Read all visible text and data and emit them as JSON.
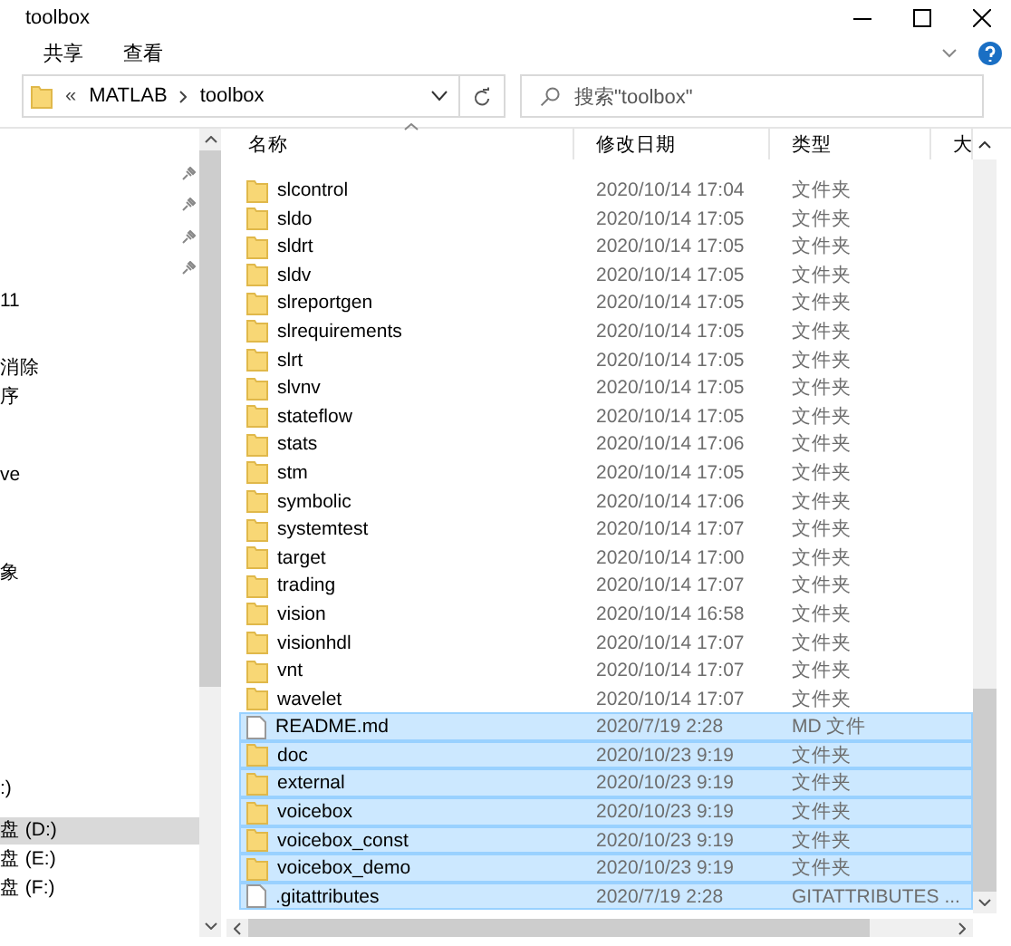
{
  "window": {
    "title": "toolbox"
  },
  "ribbon_tabs": [
    {
      "label": "共享"
    },
    {
      "label": "查看"
    }
  ],
  "address": {
    "overflow": "«",
    "segments": [
      "MATLAB",
      "toolbox"
    ]
  },
  "search": {
    "placeholder": "搜索\"toolbox\""
  },
  "nav_items": [
    {
      "kind": "pinned"
    },
    {
      "kind": "pinned"
    },
    {
      "kind": "pinned"
    },
    {
      "kind": "pinned"
    },
    {
      "kind": "item",
      "label": "11",
      "selected": false
    },
    {
      "kind": "item",
      "label": "消除",
      "selected": false
    },
    {
      "kind": "item",
      "label": "序",
      "selected": false
    },
    {
      "kind": "item",
      "label": "ve",
      "selected": false
    },
    {
      "kind": "item",
      "label": "象",
      "selected": false
    },
    {
      "kind": "item",
      "label": ":)",
      "selected": false
    },
    {
      "kind": "item",
      "label": "盘 (D:)",
      "selected": true
    },
    {
      "kind": "item",
      "label": "盘 (E:)",
      "selected": false
    },
    {
      "kind": "item",
      "label": "盘 (F:)",
      "selected": false
    }
  ],
  "columns": [
    "名称",
    "修改日期",
    "类型",
    "大"
  ],
  "files": [
    {
      "kind": "folder",
      "name": "slcontrol",
      "date": "2020/10/14 17:04",
      "type": "文件夹",
      "selected": false
    },
    {
      "kind": "folder",
      "name": "sldo",
      "date": "2020/10/14 17:05",
      "type": "文件夹",
      "selected": false
    },
    {
      "kind": "folder",
      "name": "sldrt",
      "date": "2020/10/14 17:05",
      "type": "文件夹",
      "selected": false
    },
    {
      "kind": "folder",
      "name": "sldv",
      "date": "2020/10/14 17:05",
      "type": "文件夹",
      "selected": false
    },
    {
      "kind": "folder",
      "name": "slreportgen",
      "date": "2020/10/14 17:05",
      "type": "文件夹",
      "selected": false
    },
    {
      "kind": "folder",
      "name": "slrequirements",
      "date": "2020/10/14 17:05",
      "type": "文件夹",
      "selected": false
    },
    {
      "kind": "folder",
      "name": "slrt",
      "date": "2020/10/14 17:05",
      "type": "文件夹",
      "selected": false
    },
    {
      "kind": "folder",
      "name": "slvnv",
      "date": "2020/10/14 17:05",
      "type": "文件夹",
      "selected": false
    },
    {
      "kind": "folder",
      "name": "stateflow",
      "date": "2020/10/14 17:05",
      "type": "文件夹",
      "selected": false
    },
    {
      "kind": "folder",
      "name": "stats",
      "date": "2020/10/14 17:06",
      "type": "文件夹",
      "selected": false
    },
    {
      "kind": "folder",
      "name": "stm",
      "date": "2020/10/14 17:05",
      "type": "文件夹",
      "selected": false
    },
    {
      "kind": "folder",
      "name": "symbolic",
      "date": "2020/10/14 17:06",
      "type": "文件夹",
      "selected": false
    },
    {
      "kind": "folder",
      "name": "systemtest",
      "date": "2020/10/14 17:07",
      "type": "文件夹",
      "selected": false
    },
    {
      "kind": "folder",
      "name": "target",
      "date": "2020/10/14 17:00",
      "type": "文件夹",
      "selected": false
    },
    {
      "kind": "folder",
      "name": "trading",
      "date": "2020/10/14 17:07",
      "type": "文件夹",
      "selected": false
    },
    {
      "kind": "folder",
      "name": "vision",
      "date": "2020/10/14 16:58",
      "type": "文件夹",
      "selected": false
    },
    {
      "kind": "folder",
      "name": "visionhdl",
      "date": "2020/10/14 17:07",
      "type": "文件夹",
      "selected": false
    },
    {
      "kind": "folder",
      "name": "vnt",
      "date": "2020/10/14 17:07",
      "type": "文件夹",
      "selected": false
    },
    {
      "kind": "folder",
      "name": "wavelet",
      "date": "2020/10/14 17:07",
      "type": "文件夹",
      "selected": false
    },
    {
      "kind": "file",
      "name": "README.md",
      "date": "2020/7/19 2:28",
      "type": "MD 文件",
      "selected": true
    },
    {
      "kind": "folder",
      "name": "doc",
      "date": "2020/10/23 9:19",
      "type": "文件夹",
      "selected": true
    },
    {
      "kind": "folder",
      "name": "external",
      "date": "2020/10/23 9:19",
      "type": "文件夹",
      "selected": true
    },
    {
      "kind": "folder",
      "name": "voicebox",
      "date": "2020/10/23 9:19",
      "type": "文件夹",
      "selected": true
    },
    {
      "kind": "folder",
      "name": "voicebox_const",
      "date": "2020/10/23 9:19",
      "type": "文件夹",
      "selected": true
    },
    {
      "kind": "folder",
      "name": "voicebox_demo",
      "date": "2020/10/23 9:19",
      "type": "文件夹",
      "selected": true
    },
    {
      "kind": "file",
      "name": ".gitattributes",
      "date": "2020/7/19 2:28",
      "type": "GITATTRIBUTES ...",
      "selected": true
    }
  ]
}
